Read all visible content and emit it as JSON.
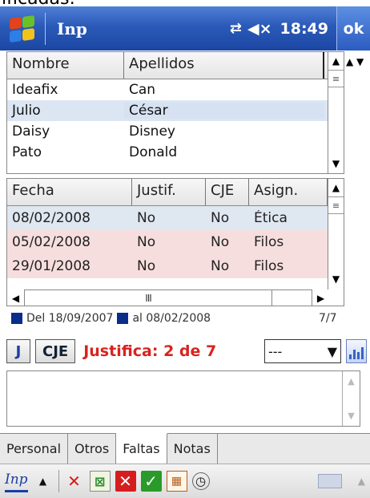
{
  "top_caption": "ificadas:",
  "titlebar": {
    "app_title": "Inp",
    "time": "18:49",
    "ok_label": "ok"
  },
  "grid1": {
    "headers": [
      "Nombre",
      "Apellidos"
    ],
    "rows": [
      [
        "Ideafix",
        "Can"
      ],
      [
        "Julio",
        "César"
      ],
      [
        "Daisy",
        "Disney"
      ],
      [
        "Pato",
        "Donald"
      ]
    ],
    "selected_row": 1
  },
  "grid2": {
    "headers": [
      "Fecha",
      "Justif.",
      "CJE",
      "Asign."
    ],
    "rows": [
      [
        "08/02/2008",
        "No",
        "No",
        "Ética"
      ],
      [
        "05/02/2008",
        "No",
        "No",
        "Filos"
      ],
      [
        "29/01/2008",
        "No",
        "No",
        "Filos"
      ]
    ],
    "hscroll_grip": "III"
  },
  "date_range": {
    "from_label": "Del 18/09/2007",
    "to_label": "al 08/02/2008",
    "count": "7/7"
  },
  "actions": {
    "j_label": "J",
    "cje_label": "CJE",
    "justifica_text": "Justifica: 2 de 7",
    "combo_value": "---"
  },
  "tabs": [
    "Personal",
    "Otros",
    "Faltas",
    "Notas"
  ],
  "active_tab": "Faltas",
  "toolbar": {
    "inp_label": "Inp"
  },
  "colors": {
    "titlebar": "#2a5ab8",
    "selected_row": "#dce6f3",
    "pink_row": "#f7dede",
    "justifica": "#d9231f",
    "date_square": "#0b2d8a"
  }
}
